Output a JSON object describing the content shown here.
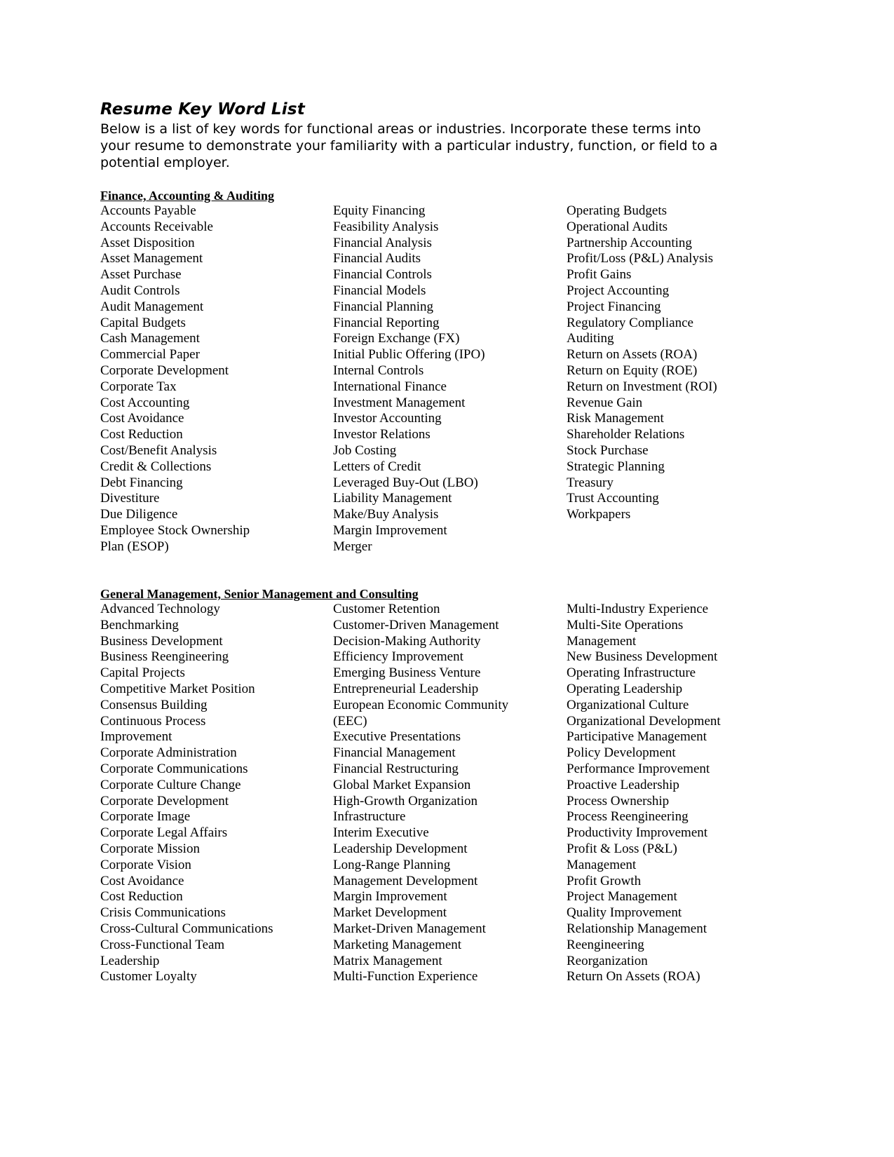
{
  "document": {
    "title": "Resume Key Word List",
    "intro": "Below is a list of key words for functional areas or industries.  Incorporate these terms into\nyour resume to demonstrate your familiarity with a particular industry, function, or field to a\npotential employer."
  },
  "sections": [
    {
      "heading": "Finance, Accounting & Auditing",
      "columns": [
        [
          "Accounts Payable",
          "Accounts Receivable",
          "Asset Disposition",
          "Asset Management",
          "Asset Purchase",
          "Audit Controls",
          "Audit Management",
          "Capital Budgets",
          "Cash Management",
          "Commercial Paper",
          "Corporate Development",
          "Corporate Tax",
          "Cost Accounting",
          "Cost Avoidance",
          "Cost Reduction",
          "Cost/Benefit Analysis",
          "Credit & Collections",
          "Debt Financing",
          "Divestiture",
          "Due Diligence",
          "Employee Stock Ownership",
          "Plan (ESOP)"
        ],
        [
          "Equity Financing",
          "Feasibility Analysis",
          "Financial Analysis",
          "Financial Audits",
          "Financial Controls",
          "Financial Models",
          "Financial Planning",
          "Financial Reporting",
          "Foreign Exchange (FX)",
          "Initial Public Offering (IPO)",
          "Internal Controls",
          "International Finance",
          "Investment Management",
          "Investor Accounting",
          "Investor Relations",
          "Job Costing",
          "Letters of Credit",
          "Leveraged Buy-Out (LBO)",
          "Liability Management",
          "Make/Buy Analysis",
          "Margin Improvement",
          "Merger"
        ],
        [
          "Operating Budgets",
          "Operational Audits",
          "Partnership Accounting",
          "Profit/Loss (P&L) Analysis",
          "Profit Gains",
          "Project Accounting",
          "Project Financing",
          "Regulatory Compliance",
          "Auditing",
          "Return on Assets (ROA)",
          "Return on Equity (ROE)",
          "Return on Investment (ROI)",
          "Revenue Gain",
          "Risk Management",
          "Shareholder Relations",
          "Stock Purchase",
          "Strategic Planning",
          "Treasury",
          "Trust Accounting",
          "Workpapers"
        ]
      ]
    },
    {
      "heading": "General Management, Senior Management and Consulting",
      "columns": [
        [
          "Advanced Technology",
          "Benchmarking",
          "Business Development",
          "Business Reengineering",
          "Capital Projects",
          "Competitive Market Position",
          "Consensus Building",
          "Continuous Process",
          "Improvement",
          "Corporate Administration",
          "Corporate Communications",
          "Corporate Culture Change",
          "Corporate Development",
          "Corporate Image",
          "Corporate Legal Affairs",
          "Corporate Mission",
          "Corporate Vision",
          "Cost Avoidance",
          "Cost Reduction",
          "Crisis Communications",
          "Cross-Cultural Communications",
          "Cross-Functional Team",
          "Leadership",
          "Customer Loyalty"
        ],
        [
          "Customer Retention",
          "Customer-Driven Management",
          "Decision-Making Authority",
          "Efficiency Improvement",
          "Emerging Business Venture",
          "Entrepreneurial Leadership",
          "European Economic Community",
          "(EEC)",
          "Executive Presentations",
          "Financial Management",
          "Financial Restructuring",
          "Global Market Expansion",
          "High-Growth Organization",
          "Infrastructure",
          "Interim Executive",
          "Leadership Development",
          "Long-Range Planning",
          "Management Development",
          "Margin Improvement",
          "Market Development",
          "Market-Driven Management",
          "Marketing Management",
          "Matrix Management",
          "Multi-Function Experience"
        ],
        [
          "Multi-Industry Experience",
          "Multi-Site Operations",
          "Management",
          "New Business Development",
          "Operating Infrastructure",
          "Operating Leadership",
          "Organizational Culture",
          "Organizational Development",
          "Participative Management",
          "Policy Development",
          "Performance Improvement",
          "Proactive Leadership",
          "Process Ownership",
          "Process Reengineering",
          "Productivity Improvement",
          "Profit & Loss (P&L)",
          "Management",
          "Profit Growth",
          "Project Management",
          "Quality Improvement",
          "Relationship Management",
          "Reengineering",
          "Reorganization",
          "Return On Assets (ROA)"
        ]
      ]
    }
  ]
}
